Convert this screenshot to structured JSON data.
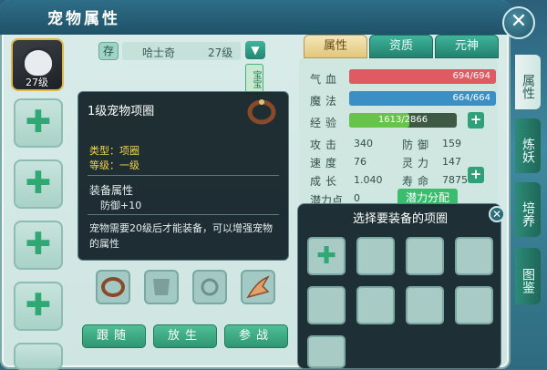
{
  "window": {
    "title": "宠物属性",
    "close_icon": "close-icon"
  },
  "pet": {
    "tag": "存",
    "name": "哈士奇",
    "level": "27级",
    "avatar_level": "27级",
    "side_tag": "宝宝"
  },
  "tooltip": {
    "title": "1级宠物项圈",
    "type_label": "类型：项圈",
    "grade_label": "等级：一级",
    "section_label": "装备属性",
    "bonus": "防御+10",
    "description": "宠物需要20级后才能装备，可以增强宠物的属性"
  },
  "actions": {
    "follow": "跟随",
    "release": "放生",
    "battle": "参战"
  },
  "tabs": [
    {
      "label": "属性",
      "active": true
    },
    {
      "label": "资质",
      "active": false
    },
    {
      "label": "元神",
      "active": false
    }
  ],
  "stats": {
    "hp_label": "气血",
    "hp_value": "694/694",
    "hp_fraction": 1.0,
    "mp_label": "魔法",
    "mp_value": "664/664",
    "mp_fraction": 1.0,
    "exp_label": "经验",
    "exp_value": "1613/2866",
    "exp_fraction": 0.563,
    "atk_label": "攻击",
    "atk_value": "340",
    "def_label": "防御",
    "def_value": "159",
    "spd_label": "速度",
    "spd_value": "76",
    "spi_label": "灵力",
    "spi_value": "147",
    "growth_label": "成长",
    "growth_value": "1.040",
    "life_label": "寿命",
    "life_value": "7875",
    "potential_label": "潜力点",
    "potential_value": "0",
    "allocate_label": "潜力分配"
  },
  "right_tabs": [
    "属性",
    "炼妖",
    "培养",
    "图鉴"
  ],
  "selector": {
    "title": "选择要装备的项圈"
  },
  "colors": {
    "hp": "#e05a63",
    "mp": "#3a8fc4",
    "exp": "#67c34a",
    "accent": "#2fa874"
  }
}
